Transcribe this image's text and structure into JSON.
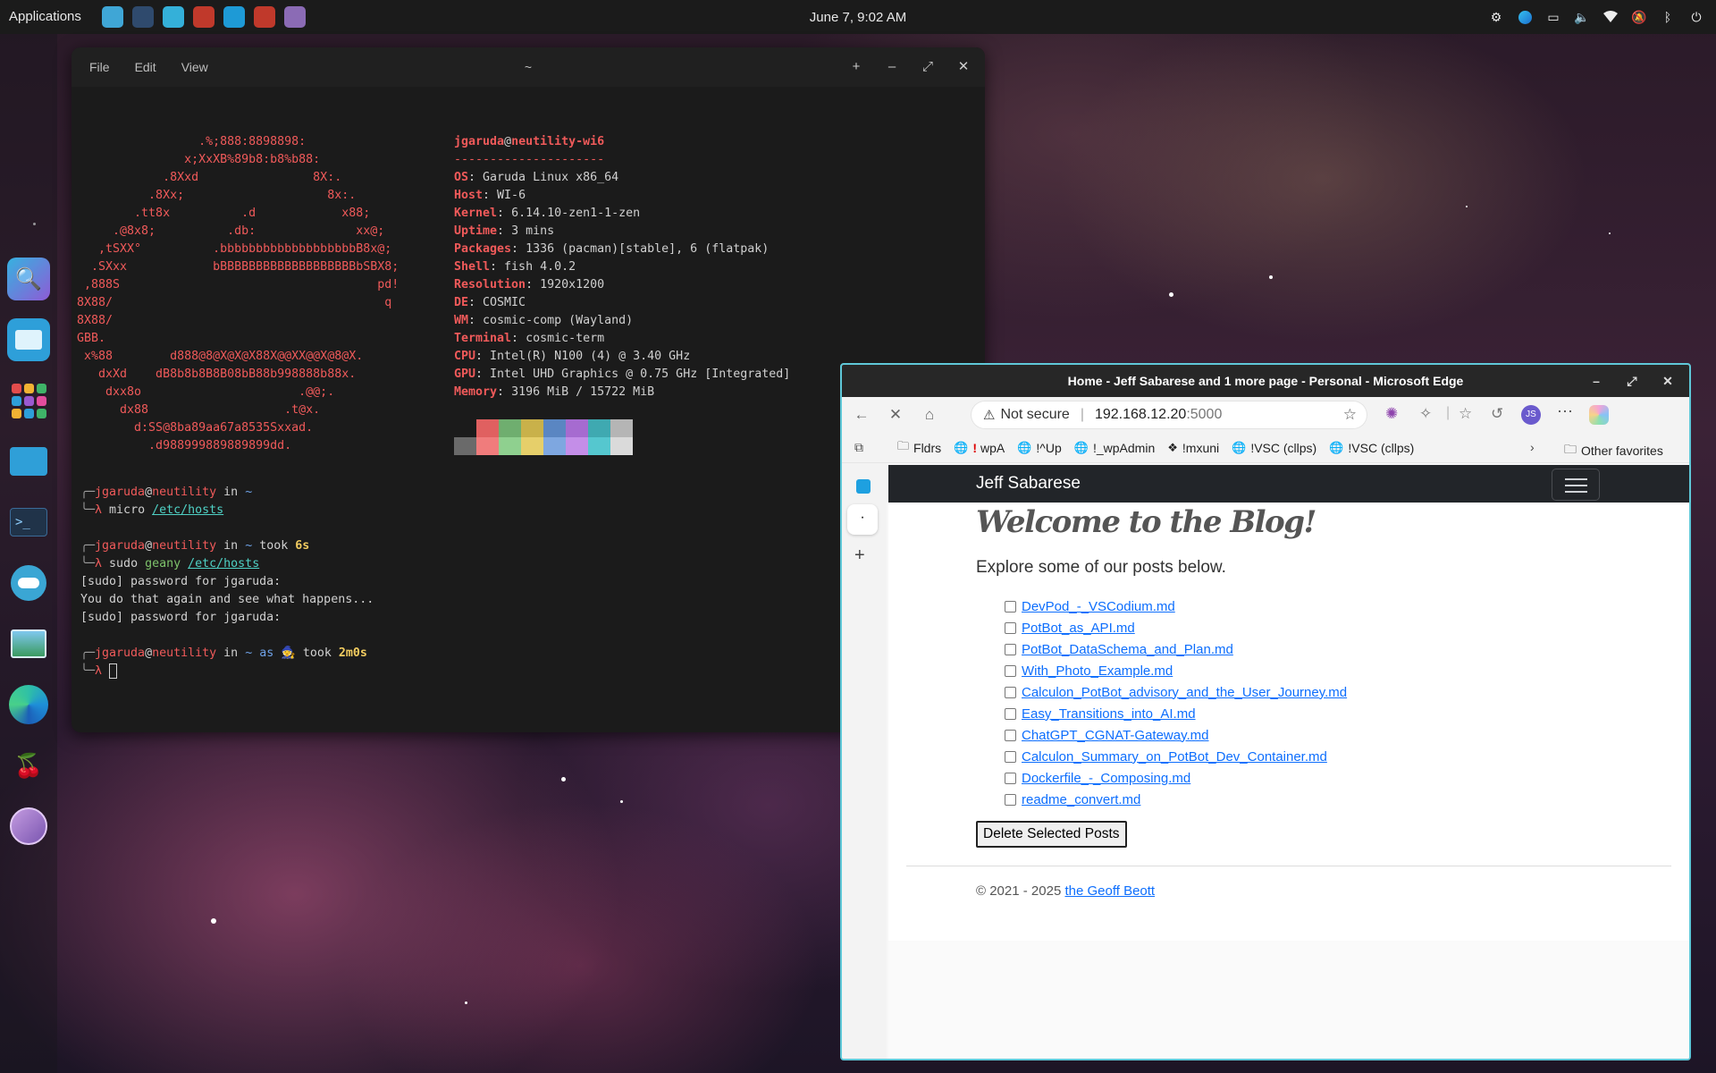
{
  "top_panel": {
    "applications_label": "Applications",
    "clock": "June 7, 9:02 AM",
    "launchers": [
      {
        "icon": "folder-icon",
        "color": "#3fa6d6"
      },
      {
        "icon": "terminal-icon",
        "color": "#2f4a6d"
      },
      {
        "icon": "store-icon",
        "color": "#34b0d9"
      },
      {
        "icon": "image-viewer-icon",
        "color": "#c0392b"
      },
      {
        "icon": "edge-icon",
        "color": "#1e9ad6"
      },
      {
        "icon": "cherry-icon",
        "color": "#c0392b"
      },
      {
        "icon": "app-icon",
        "color": "#8b6bb5"
      }
    ],
    "tray_icons": [
      "settings-icon",
      "edge-tray-icon",
      "display-icon",
      "volume-icon",
      "wifi-icon",
      "notifications-off-icon",
      "bluetooth-icon",
      "power-icon"
    ]
  },
  "dock": {
    "items": [
      "search-app-icon",
      "files-app-icon",
      "app-grid-icon",
      "folder-icon",
      "terminal-icon",
      "toggle-app-icon",
      "image-viewer-icon",
      "edge-icon",
      "cherry-icon",
      "garuda-icon"
    ]
  },
  "terminal": {
    "title": "~",
    "menu": [
      "File",
      "Edit",
      "View"
    ],
    "logo_lines": [
      "                 .%;888:8898898:",
      "               x;XxXB%89b8:b8%b88:",
      "            .8Xxd                8X:.",
      "          .8Xx;                    8x:.",
      "        .tt8x          .d            x88;",
      "     .@8x8;          .db:              xx@;",
      "   ,tSXX°          .bbbbbbbbbbbbbbbbbbbB8x@;",
      "  .SXxx            bBBBBBBBBBBBBBBBBBBBbSBX8;",
      " ,888S                                    pd!",
      "8X88/                                      q",
      "8X88/",
      "GBB.",
      " x%88        d888@8@X@X@X88X@@XX@@X@8@X.",
      "   dxXd    dB8b8b8B8B08bB88b998888b88x.",
      "    dxx8o                      .@@;.",
      "      dx88                   .t@x.",
      "        d:SS@8ba89aa67a8535Sxxad.",
      "          .d988999889889899dd."
    ],
    "user": "jgaruda",
    "host": "neutility-wi6",
    "separator": "---------------------",
    "info": [
      {
        "key": "OS",
        "value": "Garuda Linux x86_64"
      },
      {
        "key": "Host",
        "value": "WI-6"
      },
      {
        "key": "Kernel",
        "value": "6.14.10-zen1-1-zen"
      },
      {
        "key": "Uptime",
        "value": "3 mins"
      },
      {
        "key": "Packages",
        "value": "1336 (pacman)[stable], 6 (flatpak)"
      },
      {
        "key": "Shell",
        "value": "fish 4.0.2"
      },
      {
        "key": "Resolution",
        "value": "1920x1200"
      },
      {
        "key": "DE",
        "value": "COSMIC"
      },
      {
        "key": "WM",
        "value": "cosmic-comp (Wayland)"
      },
      {
        "key": "Terminal",
        "value": "cosmic-term"
      },
      {
        "key": "CPU",
        "value": "Intel(R) N100 (4) @ 3.40 GHz"
      },
      {
        "key": "GPU",
        "value": "Intel UHD Graphics @ 0.75 GHz [Integrated]"
      },
      {
        "key": "Memory",
        "value": "3196 MiB / 15722 MiB"
      }
    ],
    "palette_top": [
      "#1b1b1b",
      "#e06060",
      "#6fae6f",
      "#c9b14a",
      "#5a86c2",
      "#a66bd0",
      "#3fa9b1",
      "#b5b5b5"
    ],
    "palette_bottom": [
      "#6a6a6a",
      "#f07c7c",
      "#8fd08f",
      "#e6cf6a",
      "#7ea7e0",
      "#c48ee8",
      "#55c7cf",
      "#dadada"
    ],
    "prompt_host": "neutility",
    "in_word": "in",
    "home": "~",
    "took_word": "took",
    "lambda": "λ",
    "cmd1": "micro",
    "cmd1_arg": "/etc/hosts",
    "took1": "6s",
    "cmd2_sudo": "sudo",
    "cmd2": "geany",
    "cmd2_arg": "/etc/hosts",
    "out_lines": [
      "[sudo] password for jgaruda:",
      "You do that again and see what happens...",
      "[sudo] password for jgaruda:"
    ],
    "as_word": "as",
    "wizard": "🧙",
    "took3": "2m0s"
  },
  "browser": {
    "title": "Home - Jeff Sabarese and 1 more page - Personal - Microsoft Edge",
    "not_secure": "Not secure",
    "url_host": "192.168.12.20",
    "url_port": ":5000",
    "profile_initials": "JS",
    "bookmarks": [
      {
        "icon": "folder-icon",
        "label": "Fldrs"
      },
      {
        "icon": "globe-icon",
        "label": "wpA",
        "flag": "!"
      },
      {
        "icon": "globe-icon",
        "label": "!^Up"
      },
      {
        "icon": "globe-icon",
        "label": "!_wpAdmin"
      },
      {
        "icon": "bookmark-icon",
        "label": "!mxuni"
      },
      {
        "icon": "globe-icon",
        "label": "!VSC (cllps)"
      },
      {
        "icon": "globe-icon",
        "label": "!VSC (cllps)"
      }
    ],
    "other_favorites": "Other favorites",
    "page": {
      "brand": "Jeff Sabarese",
      "heading": "Welcome to the Blog!",
      "lead": "Explore some of our posts below.",
      "posts": [
        "DevPod_-_VSCodium.md",
        "PotBot_as_API.md",
        "PotBot_DataSchema_and_Plan.md",
        "With_Photo_Example.md",
        "Calculon_PotBot_advisory_and_the_User_Journey.md",
        "Easy_Transitions_into_AI.md",
        "ChatGPT_CGNAT-Gateway.md",
        "Calculon_Summary_on_PotBot_Dev_Container.md",
        "Dockerfile_-_Composing.md",
        "readme_convert.md"
      ],
      "delete_button": "Delete Selected Posts",
      "footer_copyright": "© 2021 - 2025",
      "footer_link": "the Geoff Beott"
    }
  }
}
